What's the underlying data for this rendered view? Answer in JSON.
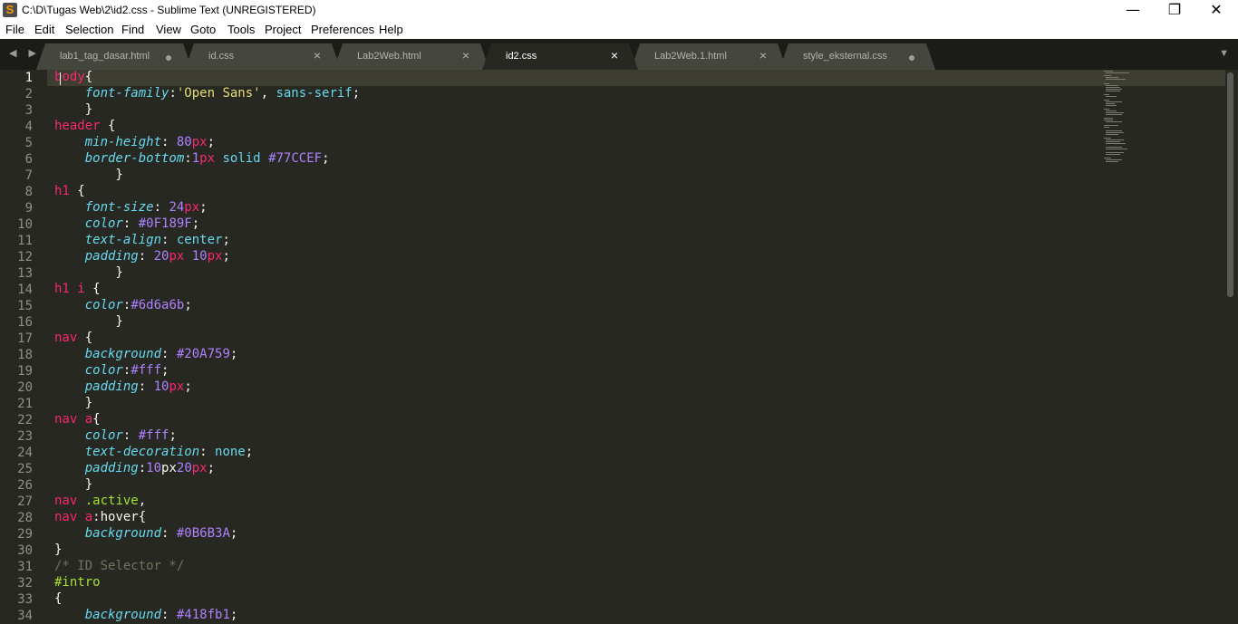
{
  "window": {
    "title": "C:\\D\\Tugas Web\\2\\id2.css - Sublime Text (UNREGISTERED)",
    "app_icon": "S",
    "minimize": "—",
    "maximize": "❐",
    "close": "✕"
  },
  "menu": [
    "File",
    "Edit",
    "Selection",
    "Find",
    "View",
    "Goto",
    "Tools",
    "Project",
    "Preferences",
    "Help"
  ],
  "tabs": [
    {
      "label": "lab1_tag_dasar.html",
      "state": "dirty",
      "active": false
    },
    {
      "label": "id.css",
      "state": "close",
      "active": false
    },
    {
      "label": "Lab2Web.html",
      "state": "close",
      "active": false
    },
    {
      "label": "id2.css",
      "state": "close",
      "active": true
    },
    {
      "label": "Lab2Web.1.html",
      "state": "close",
      "active": false
    },
    {
      "label": "style_eksternal.css",
      "state": "dirty",
      "active": false
    }
  ],
  "icons": {
    "nav_arrows": "◀ ▶",
    "tab_close": "×",
    "dropdown": "▼"
  },
  "colors": {
    "background": "#272822",
    "selector": "#f92672",
    "property": "#66d9ef",
    "number": "#ae81ff",
    "string": "#e6db74",
    "comment": "#75715e",
    "class": "#a6e22e"
  },
  "editor": {
    "current_line": 1,
    "lines": [
      {
        "n": "1",
        "t": [
          [
            "t-sel",
            "body"
          ],
          [
            "t-punc",
            "{"
          ]
        ]
      },
      {
        "n": "2",
        "t": [
          [
            "t-punc",
            "    "
          ],
          [
            "t-prop",
            "font-family"
          ],
          [
            "t-punc",
            ":"
          ],
          [
            "t-str",
            "'Open Sans'"
          ],
          [
            "t-punc",
            ", "
          ],
          [
            "t-val",
            "sans-serif"
          ],
          [
            "t-punc",
            ";"
          ]
        ]
      },
      {
        "n": "3",
        "t": [
          [
            "t-punc",
            "    }"
          ]
        ]
      },
      {
        "n": "4",
        "t": [
          [
            "t-sel",
            "header"
          ],
          [
            "t-punc",
            " {"
          ]
        ]
      },
      {
        "n": "5",
        "t": [
          [
            "t-punc",
            "    "
          ],
          [
            "t-prop",
            "min-height"
          ],
          [
            "t-punc",
            ": "
          ],
          [
            "t-num",
            "80"
          ],
          [
            "t-unit",
            "px"
          ],
          [
            "t-punc",
            ";"
          ]
        ]
      },
      {
        "n": "6",
        "t": [
          [
            "t-punc",
            "    "
          ],
          [
            "t-prop",
            "border-bottom"
          ],
          [
            "t-punc",
            ":"
          ],
          [
            "t-num",
            "1"
          ],
          [
            "t-unit",
            "px"
          ],
          [
            "t-punc",
            " "
          ],
          [
            "t-val",
            "solid"
          ],
          [
            "t-punc",
            " "
          ],
          [
            "t-num",
            "#77CCEF"
          ],
          [
            "t-punc",
            ";"
          ]
        ]
      },
      {
        "n": "7",
        "t": [
          [
            "t-punc",
            "        }"
          ]
        ]
      },
      {
        "n": "8",
        "t": [
          [
            "t-sel",
            "h1"
          ],
          [
            "t-punc",
            " {"
          ]
        ]
      },
      {
        "n": "9",
        "t": [
          [
            "t-punc",
            "    "
          ],
          [
            "t-prop",
            "font-size"
          ],
          [
            "t-punc",
            ": "
          ],
          [
            "t-num",
            "24"
          ],
          [
            "t-unit",
            "px"
          ],
          [
            "t-punc",
            ";"
          ]
        ]
      },
      {
        "n": "10",
        "t": [
          [
            "t-punc",
            "    "
          ],
          [
            "t-prop",
            "color"
          ],
          [
            "t-punc",
            ": "
          ],
          [
            "t-num",
            "#0F189F"
          ],
          [
            "t-punc",
            ";"
          ]
        ]
      },
      {
        "n": "11",
        "t": [
          [
            "t-punc",
            "    "
          ],
          [
            "t-prop",
            "text-align"
          ],
          [
            "t-punc",
            ": "
          ],
          [
            "t-val",
            "center"
          ],
          [
            "t-punc",
            ";"
          ]
        ]
      },
      {
        "n": "12",
        "t": [
          [
            "t-punc",
            "    "
          ],
          [
            "t-prop",
            "padding"
          ],
          [
            "t-punc",
            ": "
          ],
          [
            "t-num",
            "20"
          ],
          [
            "t-unit",
            "px"
          ],
          [
            "t-punc",
            " "
          ],
          [
            "t-num",
            "10"
          ],
          [
            "t-unit",
            "px"
          ],
          [
            "t-punc",
            ";"
          ]
        ]
      },
      {
        "n": "13",
        "t": [
          [
            "t-punc",
            "        }"
          ]
        ]
      },
      {
        "n": "14",
        "t": [
          [
            "t-sel",
            "h1 i"
          ],
          [
            "t-punc",
            " {"
          ]
        ]
      },
      {
        "n": "15",
        "t": [
          [
            "t-punc",
            "    "
          ],
          [
            "t-prop",
            "color"
          ],
          [
            "t-punc",
            ":"
          ],
          [
            "t-num",
            "#6d6a6b"
          ],
          [
            "t-punc",
            ";"
          ]
        ]
      },
      {
        "n": "16",
        "t": [
          [
            "t-punc",
            "        }"
          ]
        ]
      },
      {
        "n": "17",
        "t": [
          [
            "t-sel",
            "nav"
          ],
          [
            "t-punc",
            " {"
          ]
        ]
      },
      {
        "n": "18",
        "t": [
          [
            "t-punc",
            "    "
          ],
          [
            "t-prop",
            "background"
          ],
          [
            "t-punc",
            ": "
          ],
          [
            "t-num",
            "#20A759"
          ],
          [
            "t-punc",
            ";"
          ]
        ]
      },
      {
        "n": "19",
        "t": [
          [
            "t-punc",
            "    "
          ],
          [
            "t-prop",
            "color"
          ],
          [
            "t-punc",
            ":"
          ],
          [
            "t-num",
            "#fff"
          ],
          [
            "t-punc",
            ";"
          ]
        ]
      },
      {
        "n": "20",
        "t": [
          [
            "t-punc",
            "    "
          ],
          [
            "t-prop",
            "padding"
          ],
          [
            "t-punc",
            ": "
          ],
          [
            "t-num",
            "10"
          ],
          [
            "t-unit",
            "px"
          ],
          [
            "t-punc",
            ";"
          ]
        ]
      },
      {
        "n": "21",
        "t": [
          [
            "t-punc",
            "    }"
          ]
        ]
      },
      {
        "n": "22",
        "t": [
          [
            "t-sel",
            "nav a"
          ],
          [
            "t-punc",
            "{"
          ]
        ]
      },
      {
        "n": "23",
        "t": [
          [
            "t-punc",
            "    "
          ],
          [
            "t-prop",
            "color"
          ],
          [
            "t-punc",
            ": "
          ],
          [
            "t-num",
            "#fff"
          ],
          [
            "t-punc",
            ";"
          ]
        ]
      },
      {
        "n": "24",
        "t": [
          [
            "t-punc",
            "    "
          ],
          [
            "t-prop",
            "text-decoration"
          ],
          [
            "t-punc",
            ": "
          ],
          [
            "t-val",
            "none"
          ],
          [
            "t-punc",
            ";"
          ]
        ]
      },
      {
        "n": "25",
        "t": [
          [
            "t-punc",
            "    "
          ],
          [
            "t-prop",
            "padding"
          ],
          [
            "t-punc",
            ":"
          ],
          [
            "t-num",
            "10"
          ],
          [
            "t-punc",
            "px"
          ],
          [
            "t-num",
            "20"
          ],
          [
            "t-unit",
            "px"
          ],
          [
            "t-punc",
            ";"
          ]
        ]
      },
      {
        "n": "26",
        "t": [
          [
            "t-punc",
            "    }"
          ]
        ]
      },
      {
        "n": "27",
        "t": [
          [
            "t-sel",
            "nav"
          ],
          [
            "t-punc",
            " "
          ],
          [
            "t-cls",
            ".active"
          ],
          [
            "t-punc",
            ","
          ]
        ]
      },
      {
        "n": "28",
        "t": [
          [
            "t-sel",
            "nav a"
          ],
          [
            "t-punc",
            ":hover{"
          ]
        ]
      },
      {
        "n": "29",
        "t": [
          [
            "t-punc",
            "    "
          ],
          [
            "t-prop",
            "background"
          ],
          [
            "t-punc",
            ": "
          ],
          [
            "t-num",
            "#0B6B3A"
          ],
          [
            "t-punc",
            ";"
          ]
        ]
      },
      {
        "n": "30",
        "t": [
          [
            "t-punc",
            "}"
          ]
        ]
      },
      {
        "n": "31",
        "t": [
          [
            "t-com",
            "/* ID Selector */"
          ]
        ]
      },
      {
        "n": "32",
        "t": [
          [
            "t-id",
            "#intro"
          ]
        ]
      },
      {
        "n": "33",
        "t": [
          [
            "t-punc",
            "{"
          ]
        ]
      },
      {
        "n": "34",
        "t": [
          [
            "t-punc",
            "    "
          ],
          [
            "t-prop",
            "background"
          ],
          [
            "t-punc",
            ": "
          ],
          [
            "t-num",
            "#418fb1"
          ],
          [
            "t-punc",
            ";"
          ]
        ]
      }
    ]
  }
}
